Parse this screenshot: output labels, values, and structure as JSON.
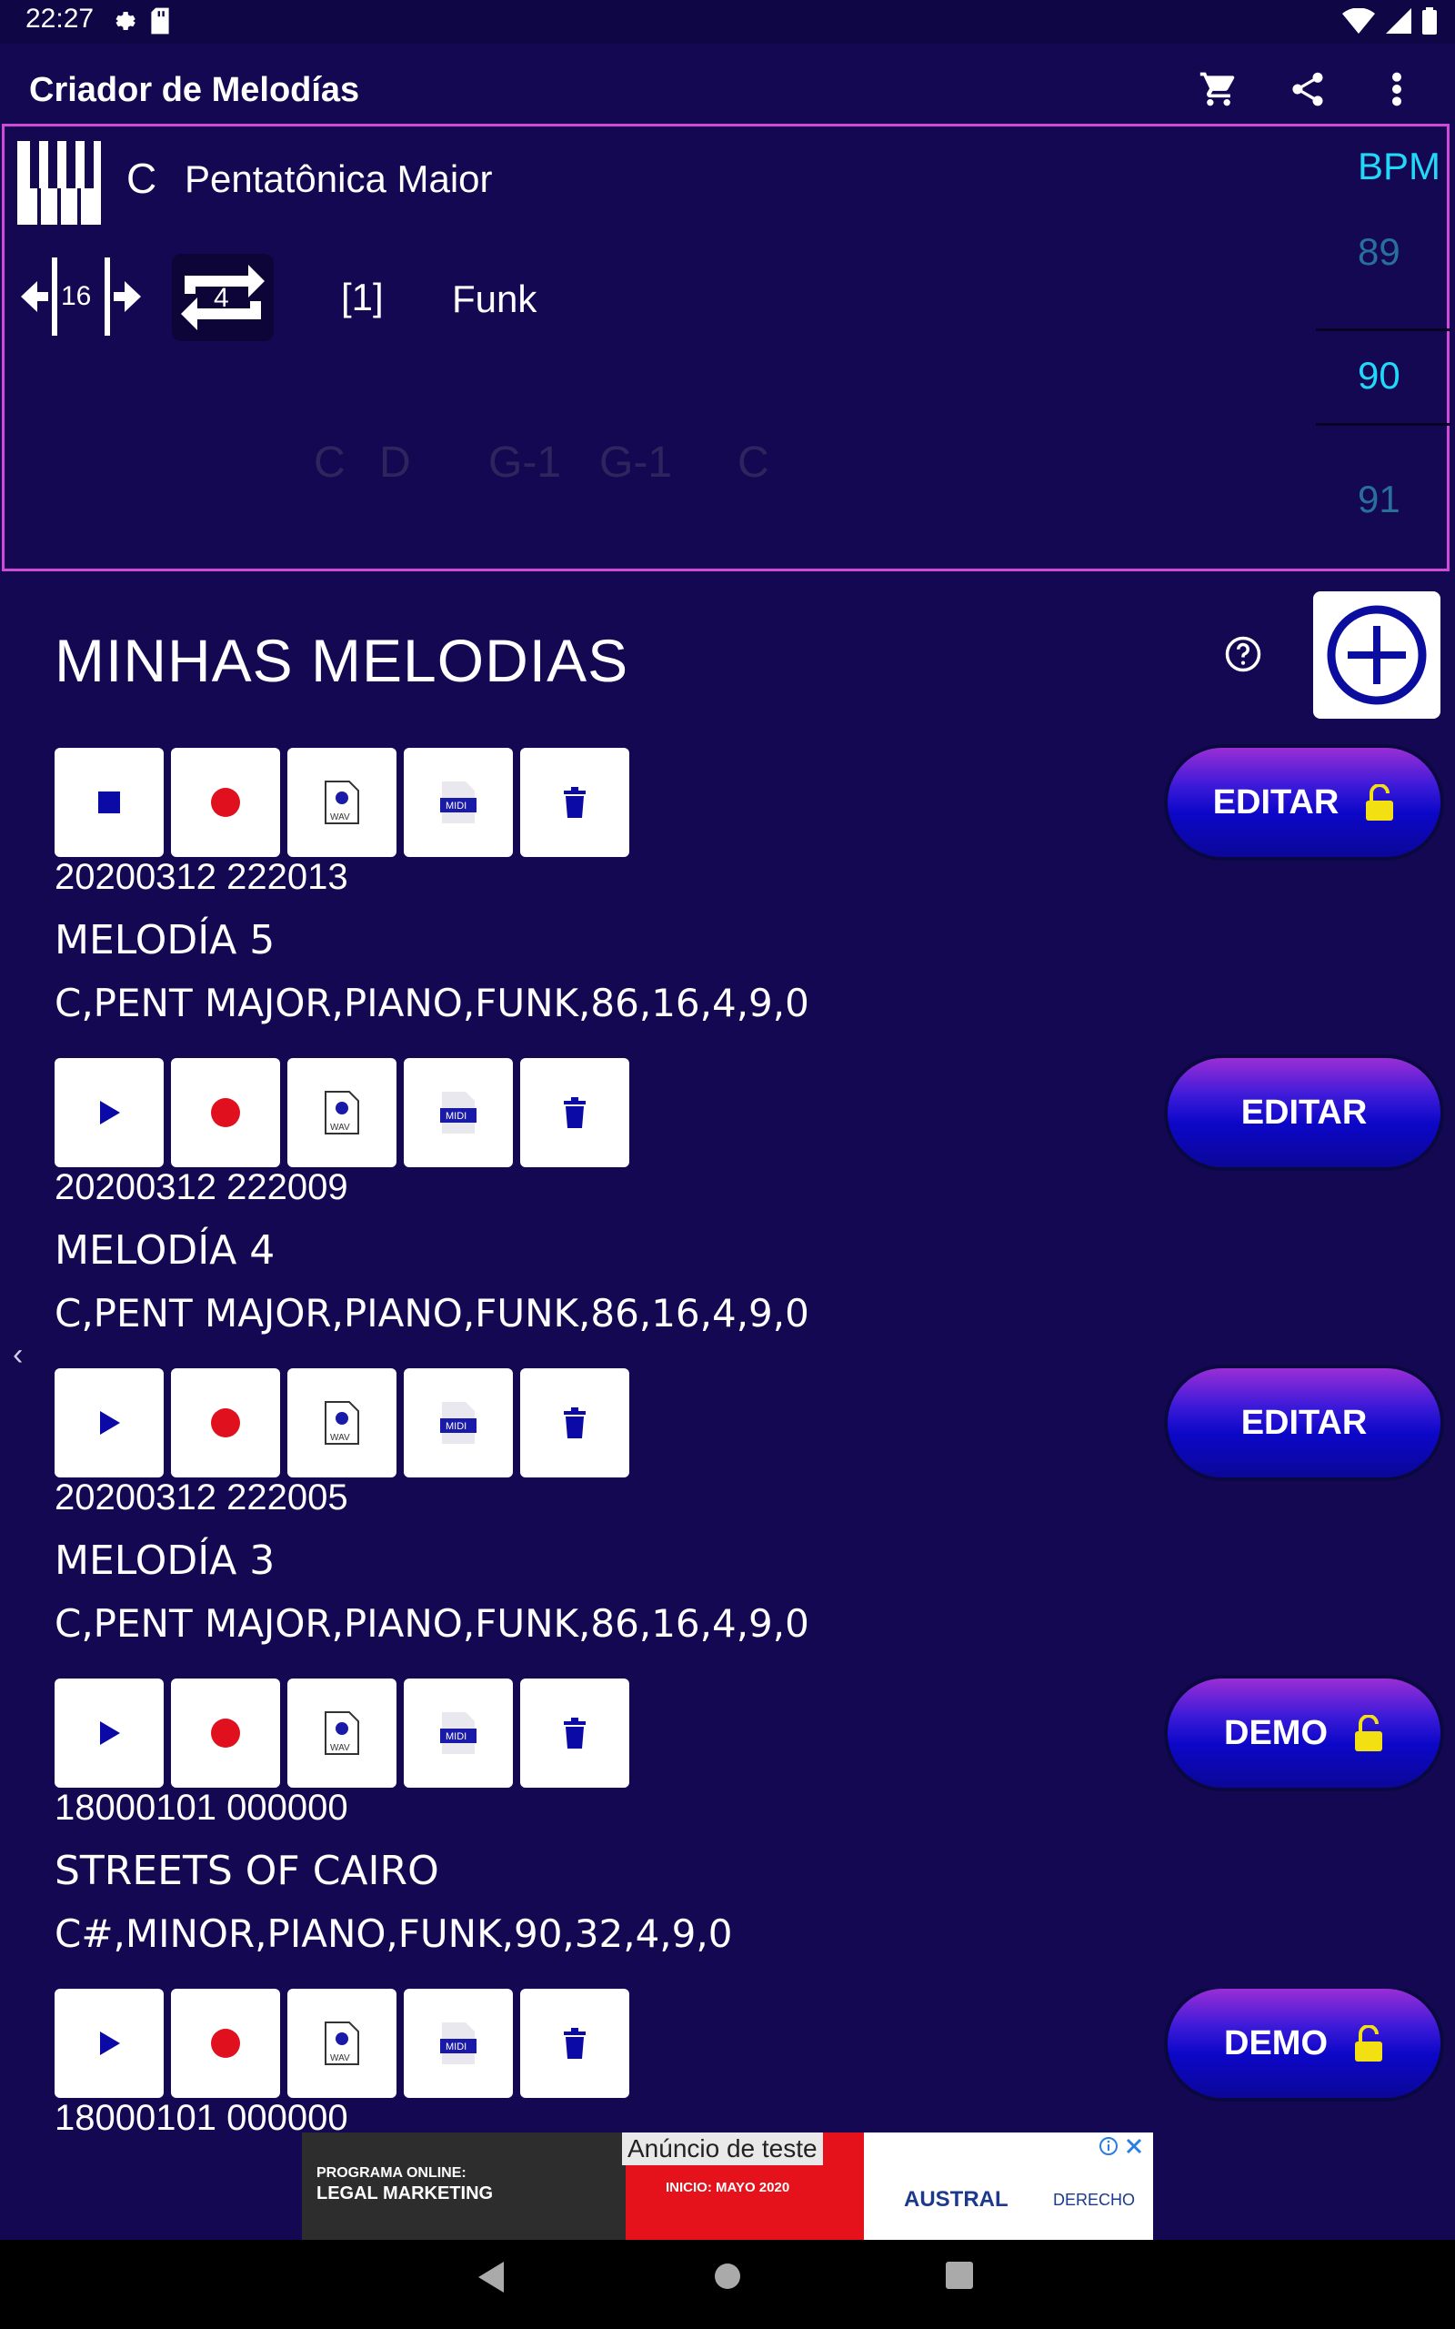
{
  "status_bar": {
    "time": "22:27"
  },
  "app_bar": {
    "title": "Criador de Melodías"
  },
  "config": {
    "key": "C",
    "scale": "Pentatônica Maior",
    "steps": "16",
    "repeat": "4",
    "pattern_index": "[1]",
    "style": "Funk",
    "chords": [
      "C",
      "D",
      "G-1",
      "G-1",
      "C"
    ],
    "bpm_label": "BPM",
    "bpm_values": [
      "89",
      "90",
      "91"
    ]
  },
  "section": {
    "title": "MINHAS MELODIAS"
  },
  "melodies": [
    {
      "date": "20200312 222013",
      "name": "MELODÍA 5",
      "params": "C,PENT MAJOR,PIANO,FUNK,86,16,4,9,0",
      "button": "EDITAR",
      "locked": true,
      "playing": true
    },
    {
      "date": "20200312 222009",
      "name": "MELODÍA 4",
      "params": "C,PENT MAJOR,PIANO,FUNK,86,16,4,9,0",
      "button": "EDITAR",
      "locked": false,
      "playing": false
    },
    {
      "date": "20200312 222005",
      "name": "MELODÍA 3",
      "params": "C,PENT MAJOR,PIANO,FUNK,86,16,4,9,0",
      "button": "EDITAR",
      "locked": false,
      "playing": false
    },
    {
      "date": "18000101 000000",
      "name": "STREETS OF CAIRO",
      "params": "C#,MINOR,PIANO,FUNK,90,32,4,9,0",
      "button": "DEMO",
      "locked": true,
      "playing": false
    },
    {
      "date": "18000101 000000",
      "name": "",
      "params": "",
      "button": "DEMO",
      "locked": true,
      "playing": false
    }
  ],
  "ad": {
    "test_label": "Anúncio de teste",
    "program": "PROGRAMA ONLINE:",
    "legal": "LEGAL MARKETING",
    "start": "INICIO: MAYO 2020",
    "brand": "AUSTRAL",
    "brand_sub": "DERECHO"
  },
  "colors": {
    "background": "#150852",
    "accent_cyan": "#22d8f8",
    "panel_border": "#d04ad8",
    "button_blue": "#0c07c8",
    "record_red": "#e0101e"
  }
}
